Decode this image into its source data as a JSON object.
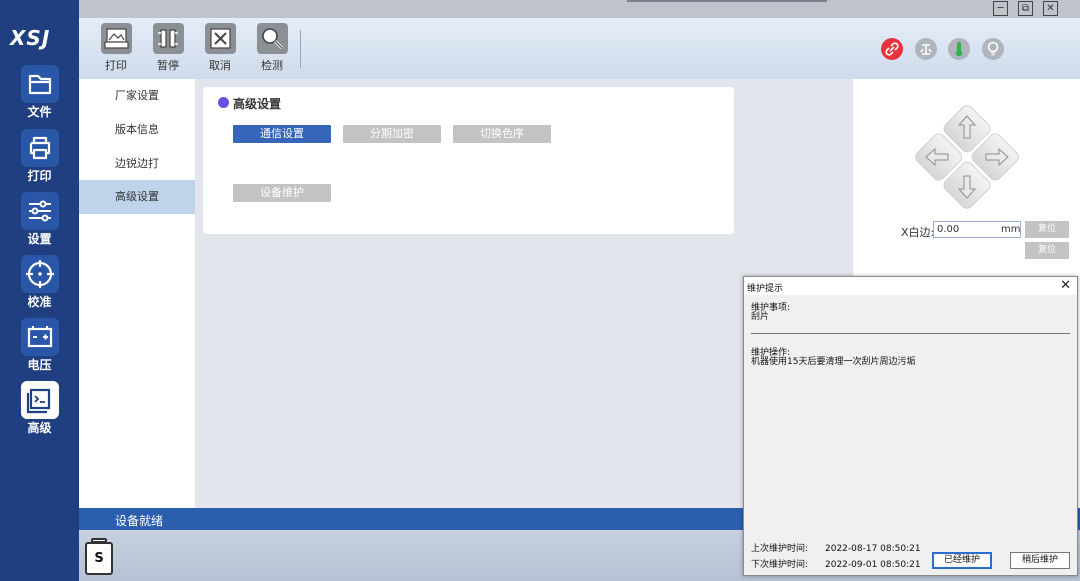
{
  "app": {
    "logo": "XSJ"
  },
  "window_controls": {
    "minimize": "─",
    "restore": "⧉",
    "close": "✕"
  },
  "nav": [
    {
      "label": "文件",
      "icon": "folder-icon"
    },
    {
      "label": "打印",
      "icon": "printer-icon"
    },
    {
      "label": "设置",
      "icon": "sliders-icon"
    },
    {
      "label": "校准",
      "icon": "crosshair-icon"
    },
    {
      "label": "电压",
      "icon": "battery-icon"
    },
    {
      "label": "高级",
      "icon": "terminal-icon",
      "active": true
    }
  ],
  "toolbar": {
    "print_label": "打印",
    "pause_label": "暂停",
    "cancel_label": "取消",
    "detect_label": "检测"
  },
  "status_icons": [
    {
      "name": "link-icon",
      "color": "#e8323c"
    },
    {
      "name": "fan-icon",
      "color": "#b0b4bc"
    },
    {
      "name": "thermometer-icon",
      "color": "#2fb34a"
    },
    {
      "name": "bulb-icon",
      "color": "#b0b4bc"
    }
  ],
  "submenu": [
    {
      "label": "厂家设置"
    },
    {
      "label": "版本信息"
    },
    {
      "label": "边锐边打"
    },
    {
      "label": "高级设置",
      "active": true
    }
  ],
  "card": {
    "title": "高级设置",
    "buttons": [
      {
        "label": "通信设置",
        "active": true
      },
      {
        "label": "分期加密"
      },
      {
        "label": "切换色序"
      }
    ],
    "maintenance_button": "设备维护"
  },
  "control_panel": {
    "x_label": "X白边:",
    "x_value": "0.00",
    "x_unit": "mm",
    "reset_label_1": "复位",
    "reset_label_2": "复位"
  },
  "status_bar": {
    "text": "设备就绪"
  },
  "bottom": {
    "s_label": "S"
  },
  "dialog": {
    "title": "维护提示",
    "close": "✕",
    "item_heading": "维护事项:",
    "item_value": "刮片",
    "op_heading": "维护操作:",
    "op_value": "机器使用15天后要清理一次刮片周边污垢",
    "last_label": "上次维护时间:",
    "last_value": "2022-08-17 08:50:21",
    "next_label": "下次维护时间:",
    "next_value": "2022-09-01 08:50:21",
    "done_button": "已经维护",
    "later_button": "稍后维护"
  },
  "colors": {
    "sidebar": "#1f3f80",
    "accent": "#3566b8",
    "statusbar": "#2b5fae"
  }
}
